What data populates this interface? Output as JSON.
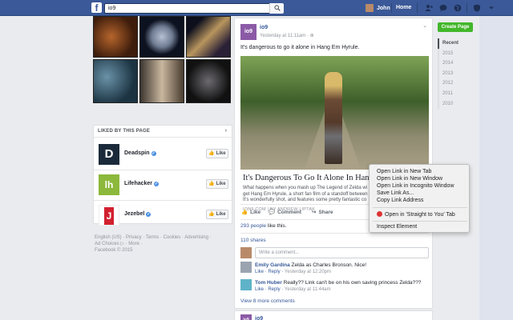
{
  "topbar": {
    "search_value": "io9",
    "user_name": "John",
    "home_label": "Home"
  },
  "liked": {
    "title": "LIKED BY THIS PAGE",
    "pages": [
      {
        "name": "Deadspin",
        "logo": "D",
        "color": "#1b2a3a",
        "like_label": "Like"
      },
      {
        "name": "Lifehacker",
        "logo": "lh",
        "color": "#8cb83b",
        "like_label": "Like"
      },
      {
        "name": "Jezebel",
        "logo": "J",
        "color": "#d2202f",
        "like_label": "Like"
      }
    ]
  },
  "footer": {
    "line1": "English (US) · Privacy · Terms · Cookies · Advertising ·",
    "line2": "Ad Choices ▷ · More ·",
    "line3": "Facebook © 2015"
  },
  "post": {
    "page_name": "io9",
    "avatar_text": "io9",
    "timestamp": "Yesterday at 11:11am · ⊕",
    "text": "It's dangerous to go it alone in Hang Em Hyrule.",
    "link_title": "It's Dangerous To Go It Alone In Hang 'Em Hyrule",
    "link_desc1": "What happens when you mash up The Legend of Zelda wi",
    "link_desc2": "get Hang Em Hyrule, a short fan film of a standoff between",
    "link_desc3": "It's wonderfully shot, and features some pretty fantastic co",
    "link_source": "ION9.COM  |  BY ANDREW LIPTAK",
    "actions": {
      "like": "Like",
      "comment": "Comment",
      "share": "Share"
    },
    "likes_link": "293 people",
    "likes_rest": " like this.",
    "shares": "110 shares",
    "comment_placeholder": "Write a comment...",
    "comments": [
      {
        "name": "Emily Gardina",
        "text": " Zelda as Charles Bronson. Nice!",
        "actions": "Like · Reply · ",
        "time": "Yesterday at 12:20pm"
      },
      {
        "name": "Tom Huber",
        "text": " Really?? Link can't be on his own saving princess Zelda???",
        "actions": "Like · Reply · ",
        "time": "Yesterday at 11:44am"
      }
    ],
    "view_more": "View 8 more comments"
  },
  "post2": {
    "avatar_text": "io9",
    "page_name": "io9"
  },
  "sidebar": {
    "create_page": "Create Page",
    "years": [
      "Recent",
      "2015",
      "2014",
      "2013",
      "2012",
      "2011",
      "2010"
    ]
  },
  "context_menu": {
    "items": [
      "Open Link in New Tab",
      "Open Link in New Window",
      "Open Link in Incognito Window",
      "Save Link As...",
      "Copy Link Address"
    ],
    "extension_item": "Open in 'Straight to You' Tab",
    "inspect": "Inspect Element"
  },
  "colors": {
    "topbar": "#3b5998",
    "link": "#365899",
    "create_page": "#42b72a"
  }
}
